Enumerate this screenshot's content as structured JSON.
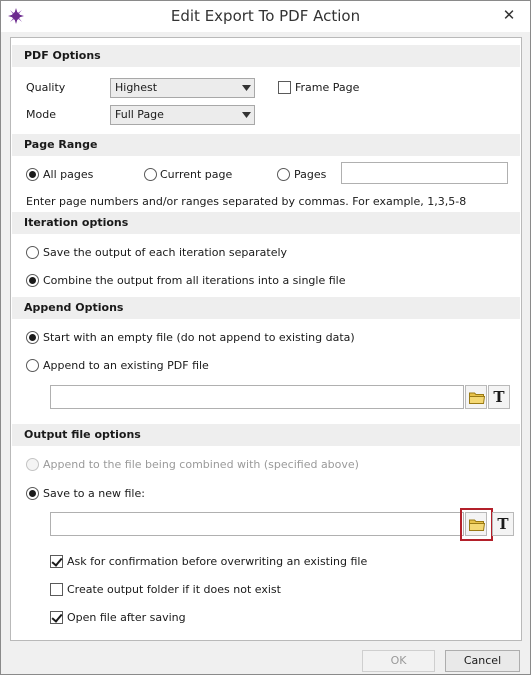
{
  "window": {
    "title": "Edit Export To PDF Action"
  },
  "pdf_options": {
    "header": "PDF Options",
    "quality_label": "Quality",
    "quality_value": "Highest",
    "mode_label": "Mode",
    "mode_value": "Full Page",
    "frame_page_label": "Frame Page",
    "frame_page_checked": false
  },
  "page_range": {
    "header": "Page Range",
    "all_pages": "All pages",
    "current_page": "Current page",
    "pages": "Pages",
    "pages_value": "",
    "selected": "All pages",
    "hint": "Enter page numbers and/or ranges separated by commas. For example, 1,3,5-8"
  },
  "iteration": {
    "header": "Iteration options",
    "separate": "Save the output of each iteration separately",
    "combine": "Combine the output from all iterations into a single file",
    "selected": "combine"
  },
  "append": {
    "header": "Append Options",
    "empty": "Start with an empty file (do not append to existing data)",
    "existing": "Append to an existing PDF file",
    "path_value": "",
    "selected": "empty"
  },
  "output": {
    "header": "Output file options",
    "append_combined": "Append to the file being combined with (specified above)",
    "save_new": "Save to a new file:",
    "path_value": "",
    "confirm_overwrite": "Ask for confirmation before overwriting an existing file",
    "create_folder": "Create output folder if it does not exist",
    "open_after": "Open file after saving",
    "confirm_overwrite_checked": true,
    "create_folder_checked": false,
    "open_after_checked": true
  },
  "buttons": {
    "ok": "OK",
    "cancel": "Cancel"
  },
  "icons": {
    "app": "fcs-app-icon",
    "close": "close-icon",
    "folder": "folder-icon",
    "text_token": "text-token-icon"
  },
  "colors": {
    "highlight": "#b3202a",
    "section_bg": "#eeeeee",
    "folder": "#e8c24a"
  }
}
